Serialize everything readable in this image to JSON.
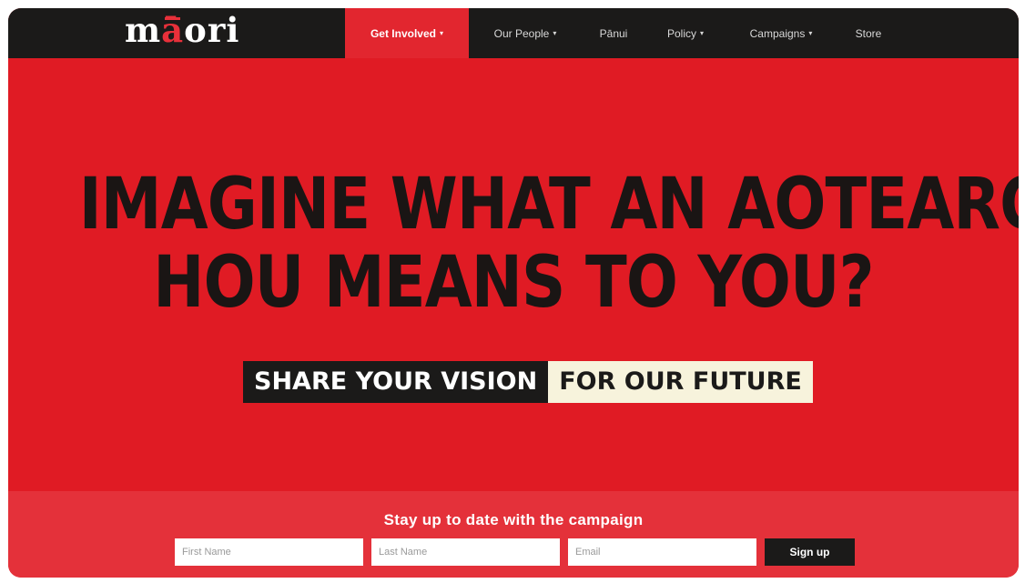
{
  "logo": {
    "prefix": "m",
    "accent": "ā",
    "suffix": "ori"
  },
  "nav": {
    "items": [
      {
        "label": "Get Involved",
        "caret": "▾"
      },
      {
        "label": "Our People",
        "caret": "▾"
      },
      {
        "label": "Pānui",
        "caret": ""
      },
      {
        "label": "Policy",
        "caret": "▾"
      },
      {
        "label": "Campaigns",
        "caret": "▾"
      },
      {
        "label": "Store",
        "caret": ""
      }
    ]
  },
  "hero": {
    "headline_line1": "IMAGINE WHAT AN AOTEAROA",
    "headline_line2": "HOU MEANS TO YOU?",
    "tagline_dark": "SHARE YOUR VISION",
    "tagline_light": "FOR OUR FUTURE"
  },
  "signup": {
    "title": "Stay up to date with the campaign",
    "first_name_placeholder": "First Name",
    "last_name_placeholder": "Last Name",
    "email_placeholder": "Email",
    "button_label": "Sign up"
  },
  "colors": {
    "brand_red": "#e01b24",
    "nav_dark": "#1b1a19",
    "nav_active": "#e2262f",
    "signup_bar": "#e4313a",
    "cream": "#f7f3dc"
  }
}
